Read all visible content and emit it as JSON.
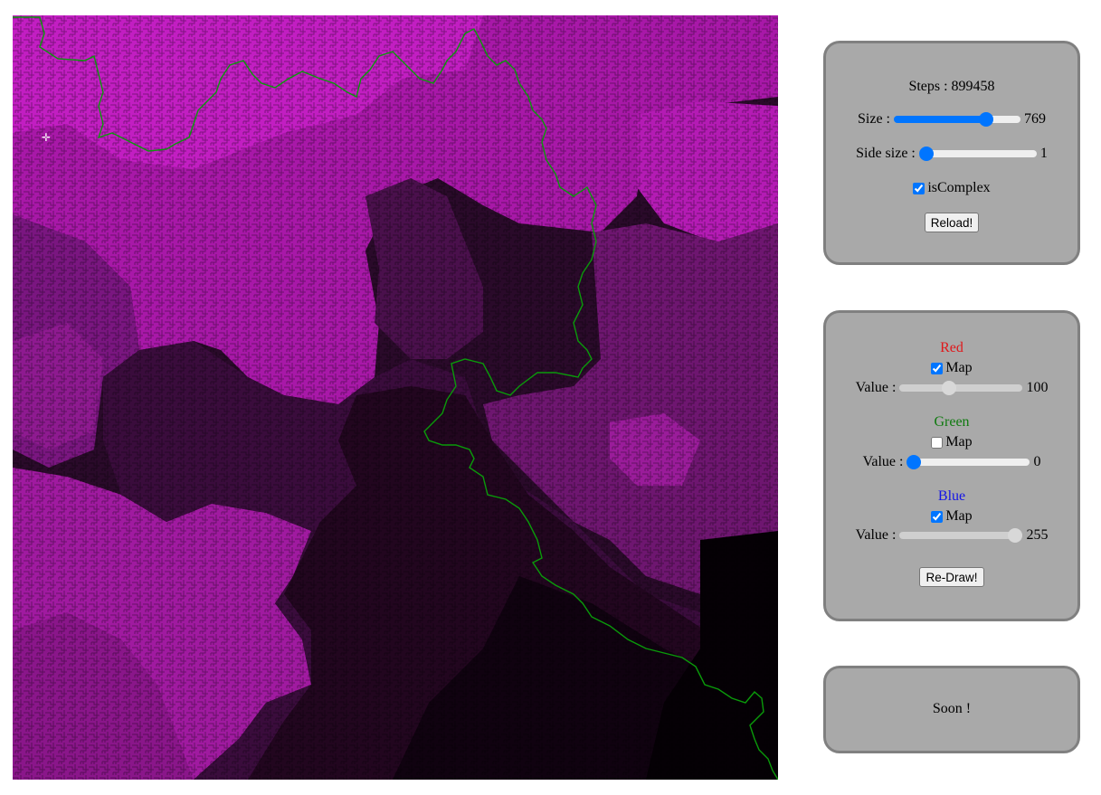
{
  "controls": {
    "steps_label": "Steps : 899458",
    "size_label": "Size :",
    "size_value": "769",
    "size_slider": 0.76,
    "side_size_label": "Side size :",
    "side_size_value": "1",
    "side_size_slider": 0.0,
    "is_complex_label": "isComplex",
    "is_complex_checked": true,
    "reload_label": "Reload!"
  },
  "color_map": {
    "red": {
      "title": "Red",
      "map_label": "Map",
      "map_checked": true,
      "value_label": "Value :",
      "value": "100",
      "slider": 0.39,
      "enabled": false
    },
    "green": {
      "title": "Green",
      "map_label": "Map",
      "map_checked": false,
      "value_label": "Value :",
      "value": "0",
      "slider": 0.0,
      "enabled": true
    },
    "blue": {
      "title": "Blue",
      "map_label": "Map",
      "map_checked": true,
      "value_label": "Value :",
      "value": "255",
      "slider": 1.0,
      "enabled": false
    },
    "redraw_label": "Re-Draw!"
  },
  "soon_panel": {
    "text": "Soon !"
  },
  "colors": {
    "maze_bright": "#c81ec8",
    "maze_dark": "#000000",
    "path": "#0a9a0a",
    "panel_bg": "#a9a9a9",
    "panel_border": "#808080",
    "accent": "#0075ff"
  }
}
